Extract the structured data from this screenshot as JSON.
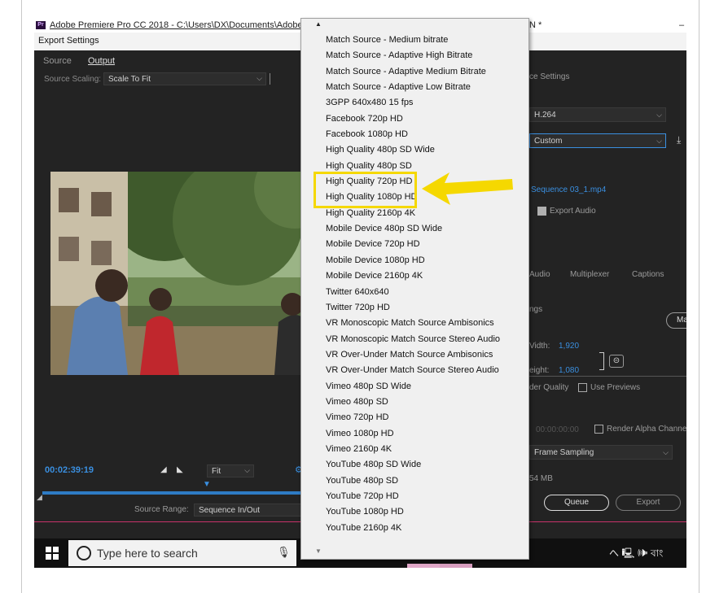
{
  "window": {
    "title_left": "Adobe Premiere Pro CC 2018 - C:\\Users\\DX\\Documents\\Adobe\\Pr",
    "title_right": "N *",
    "minimize": "–",
    "dialog_title": "Export Settings"
  },
  "left_panel": {
    "tabs": [
      "Source",
      "Output"
    ],
    "active_tab": "Output",
    "source_scaling_label": "Source Scaling:",
    "source_scaling_value": "Scale To Fit",
    "timecode": "00:02:39:19",
    "fit_value": "Fit",
    "source_range_label": "Source Range:",
    "source_range_value": "Sequence In/Out"
  },
  "right_panel": {
    "export_settings_heading": "ce Settings",
    "format_value": "H.264",
    "preset_value": "Custom",
    "output_name": "Sequence 03_1.mp4",
    "export_audio_label": "Export Audio",
    "export_audio_checked": true,
    "tabs": [
      "Audio",
      "Multiplexer",
      "Captions"
    ],
    "settings_heading": "ngs",
    "match_button": "Ma",
    "width_label": "Vidth:",
    "width_value": "1,920",
    "height_label": "eight:",
    "height_value": "1,080",
    "render_quality_label": "der Quality",
    "use_previews_label": "Use Previews",
    "render_time": "00:00:00:00",
    "render_alpha_label": "Render Alpha Channel",
    "frame_sampling_value": "Frame Sampling",
    "file_size": "54 MB",
    "queue_button": "Queue",
    "export_button": "Export"
  },
  "preset_dropdown": {
    "items": [
      "Match Source - Medium bitrate",
      "Match Source - Adaptive High Bitrate",
      "Match Source - Adaptive Medium Bitrate",
      "Match Source - Adaptive Low Bitrate",
      "3GPP 640x480 15 fps",
      "Facebook 720p HD",
      "Facebook 1080p HD",
      "High Quality 480p SD Wide",
      "High Quality 480p SD",
      "High Quality 720p HD",
      "High Quality 1080p HD",
      "High Quality 2160p 4K",
      "Mobile Device 480p SD Wide",
      "Mobile Device 720p HD",
      "Mobile Device 1080p HD",
      "Mobile Device 2160p 4K",
      "Twitter 640x640",
      "Twitter 720p HD",
      "VR Monoscopic Match Source Ambisonics",
      "VR Monoscopic Match Source Stereo Audio",
      "VR Over-Under Match Source Ambisonics",
      "VR Over-Under Match Source Stereo Audio",
      "Vimeo 480p SD Wide",
      "Vimeo 480p SD",
      "Vimeo 720p HD",
      "Vimeo 1080p HD",
      "Vimeo 2160p 4K",
      "YouTube 480p SD Wide",
      "YouTube 480p SD",
      "YouTube 720p HD",
      "YouTube 1080p HD",
      "YouTube 2160p 4K"
    ],
    "highlighted": [
      "High Quality 720p HD",
      "High Quality 1080p HD"
    ],
    "highlight_color": "#f5d800"
  },
  "taskbar": {
    "search_placeholder": "Type here to search",
    "tray_text": "へ 🖳 🕪 বাং"
  },
  "colors": {
    "accent_blue": "#3a8fe0",
    "panel_bg": "#232323",
    "annotation_yellow": "#f5d800"
  }
}
